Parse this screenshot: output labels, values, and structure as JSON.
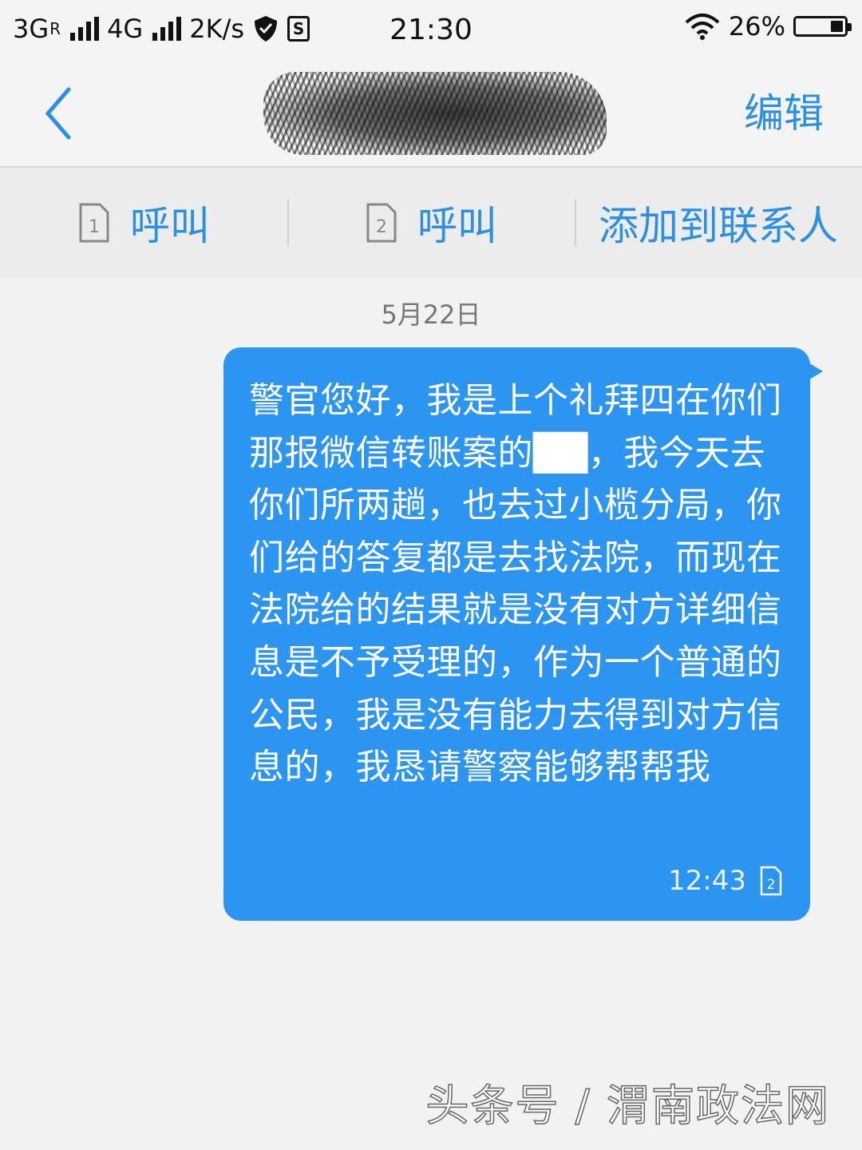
{
  "status_bar": {
    "network_1": "3G",
    "network_1_sup": "R",
    "network_2": "4G",
    "speed": "2K/s",
    "time": "21:30",
    "battery_text": "26%",
    "battery_level": 0.26
  },
  "header": {
    "contact_name": "████████",
    "edit_label": "编辑"
  },
  "actions": {
    "call_sim1_label": "呼叫",
    "call_sim1_sim": "1",
    "call_sim2_label": "呼叫",
    "call_sim2_sim": "2",
    "add_contact_label": "添加到联系人"
  },
  "conversation": {
    "date": "5月22日",
    "messages": [
      {
        "text": "警官您好，我是上个礼拜四在你们那报微信转账案的██，我今天去你们所两趟，也去过小榄分局，你们给的答复都是去找法院，而现在法院给的结果就是没有对方详细信息是不予受理的，作为一个普通的公民，我是没有能力去得到对方信息的，我恳请警察能够帮帮我",
        "time": "12:43",
        "sim": "2"
      }
    ]
  },
  "watermark": "头条号 / 渭南政法网",
  "colors": {
    "accent": "#2a8fe6",
    "bubble": "#2b95f1",
    "background": "#f2f2f2"
  }
}
